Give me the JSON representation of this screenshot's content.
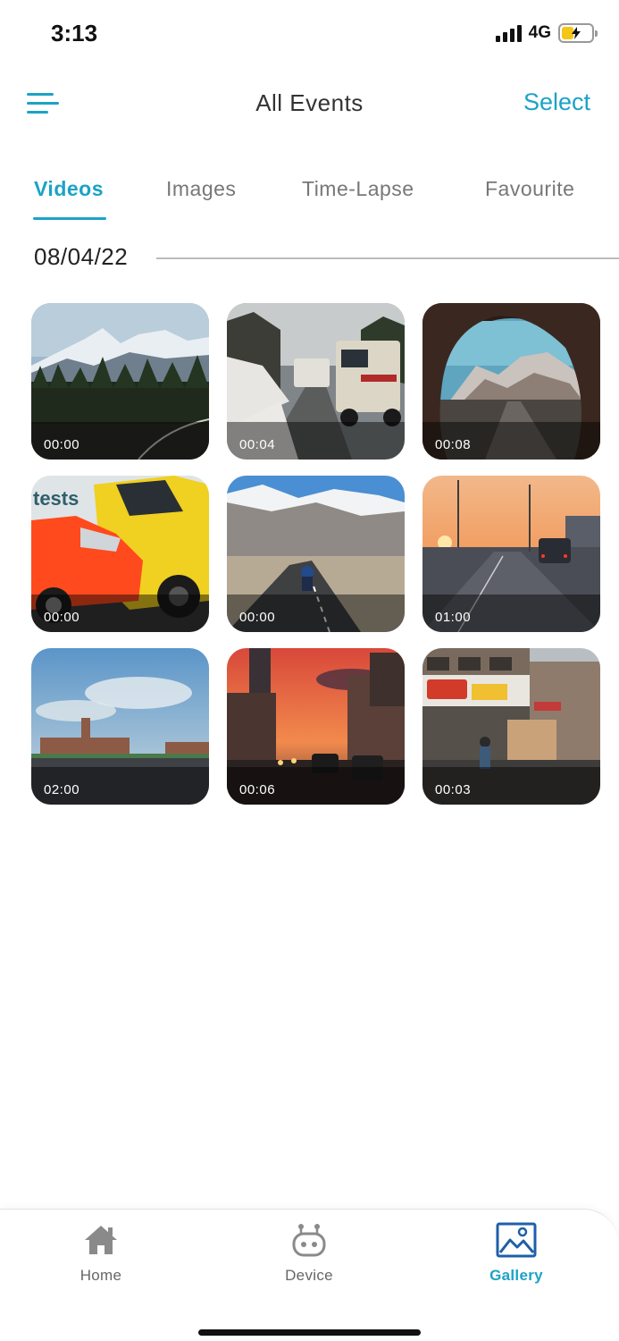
{
  "status_bar": {
    "time": "3:13",
    "network": "4G",
    "signal_icon": "cellular-signal-icon",
    "battery_icon": "battery-charging-icon"
  },
  "header": {
    "menu_icon": "hamburger-menu-icon",
    "title": "All Events",
    "select_label": "Select"
  },
  "tabs": [
    {
      "label": "Videos",
      "active": true
    },
    {
      "label": "Images",
      "active": false
    },
    {
      "label": "Time-Lapse",
      "active": false
    },
    {
      "label": "Favourite",
      "active": false
    }
  ],
  "section": {
    "date": "08/04/22"
  },
  "videos": [
    {
      "duration": "00:00"
    },
    {
      "duration": "00:04"
    },
    {
      "duration": "00:08"
    },
    {
      "duration": "00:00",
      "overlay_text": "tests"
    },
    {
      "duration": "00:00"
    },
    {
      "duration": "01:00"
    },
    {
      "duration": "02:00"
    },
    {
      "duration": "00:06"
    },
    {
      "duration": "00:03"
    }
  ],
  "bottom_nav": [
    {
      "label": "Home",
      "icon": "home-icon",
      "active": false
    },
    {
      "label": "Device",
      "icon": "robot-device-icon",
      "active": false
    },
    {
      "label": "Gallery",
      "icon": "gallery-image-icon",
      "active": true
    }
  ],
  "colors": {
    "accent": "#1ba3c6",
    "inactive_text": "#777777",
    "battery_fill": "#f5c518"
  }
}
